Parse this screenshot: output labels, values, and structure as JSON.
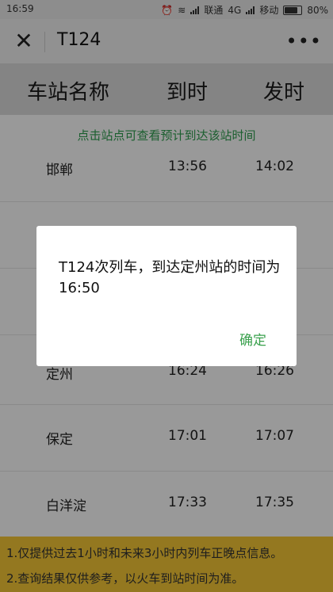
{
  "status_bar": {
    "time": "16:59",
    "carrier1": "联通",
    "network": "4G",
    "carrier2": "移动",
    "battery": "80%"
  },
  "nav": {
    "title": "T124"
  },
  "table": {
    "headers": [
      "车站名称",
      "到时",
      "发时"
    ],
    "hint": "点击站点可查看预计到达该站时间",
    "rows": [
      {
        "station": "邯郸",
        "arrive": "13:56",
        "depart": "14:02"
      },
      {
        "station": "定州",
        "arrive": "16:24",
        "depart": "16:26"
      },
      {
        "station": "保定",
        "arrive": "17:01",
        "depart": "17:07"
      },
      {
        "station": "白洋淀",
        "arrive": "17:33",
        "depart": "17:35"
      }
    ]
  },
  "notice": {
    "line1": "1.仅提供过去1小时和未来3小时内列车正晚点信息。",
    "line2": "2.查询结果仅供参考，以火车到站时间为准。"
  },
  "dialog": {
    "message": "T124次列车，到达定州站的时间为16:50",
    "ok_label": "确定"
  },
  "colors": {
    "accent_green": "#3aa14d",
    "notice_yellow": "#f7c836"
  }
}
